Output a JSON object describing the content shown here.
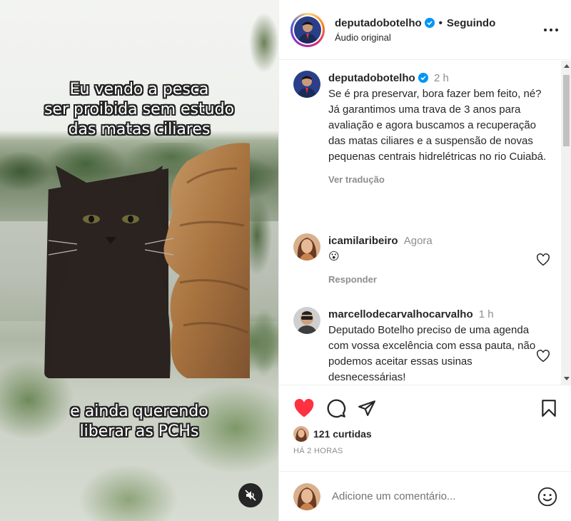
{
  "media": {
    "caption_top": "Eu vendo a pesca\nser proibida sem estudo\ndas matas ciliares",
    "caption_bottom": "e ainda querendo\nliberar as PCHs",
    "mute_icon": "speaker-muted-icon"
  },
  "header": {
    "username": "deputadobotelho",
    "separator": "•",
    "following_label": "Seguindo",
    "audio": "Áudio original",
    "more_icon": "more-horizontal-icon"
  },
  "post": {
    "username": "deputadobotelho",
    "time": "2 h",
    "caption": "Se é pra preservar, bora fazer bem feito, né?\nJá garantimos uma trava de 3 anos para avaliação e agora buscamos a recuperação das matas ciliares e a suspensão de novas pequenas centrais hidrelétricas no rio Cuiabá.",
    "translate_label": "Ver tradução"
  },
  "comments": [
    {
      "username": "icamilaribeiro",
      "time": "Agora",
      "text": "😮",
      "reply_label": "Responder"
    },
    {
      "username": "marcellodecarvalhocarvalho",
      "time": "1 h",
      "text": "Deputado Botelho preciso de uma agenda com vossa excelência com essa pauta, não podemos aceitar essas usinas desnecessárias!"
    }
  ],
  "actions": {
    "like_icon": "heart-filled-icon",
    "comment_icon": "comment-icon",
    "share_icon": "share-icon",
    "save_icon": "bookmark-icon",
    "like_color": "#ff3040"
  },
  "likes": {
    "text": "121 curtidas"
  },
  "time_ago": "HÁ 2 HORAS",
  "add_comment": {
    "placeholder": "Adicione um comentário...",
    "emoji_icon": "smiley-icon"
  }
}
